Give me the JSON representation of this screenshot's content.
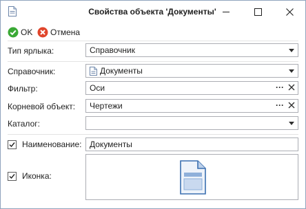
{
  "window": {
    "title": "Свойства объекта 'Документы'",
    "icons": {
      "app": "document-icon",
      "minimize": "minimize-icon",
      "maximize": "maximize-icon",
      "close": "close-icon"
    }
  },
  "toolbar": {
    "ok_label": "OK",
    "cancel_label": "Отмена",
    "ok_icon": "check-circle-icon",
    "cancel_icon": "cancel-circle-icon"
  },
  "form": {
    "shortcut_type": {
      "label": "Тип ярлыка:",
      "value": "Справочник"
    },
    "directory": {
      "label": "Справочник:",
      "value": "Документы",
      "icon": "document-icon"
    },
    "filter": {
      "label": "Фильтр:",
      "value": "Оси"
    },
    "root_object": {
      "label": "Корневой объект:",
      "value": "Чертежи"
    },
    "catalog": {
      "label": "Каталог:",
      "value": ""
    },
    "name": {
      "label": "Наименование:",
      "value": "Документы",
      "checked": true
    },
    "icon": {
      "label": "Иконка:",
      "checked": true,
      "preview_icon": "document-icon"
    }
  },
  "colors": {
    "ok_green": "#3aa935",
    "cancel_red": "#e0452b",
    "accent": "#2b6cb5"
  }
}
